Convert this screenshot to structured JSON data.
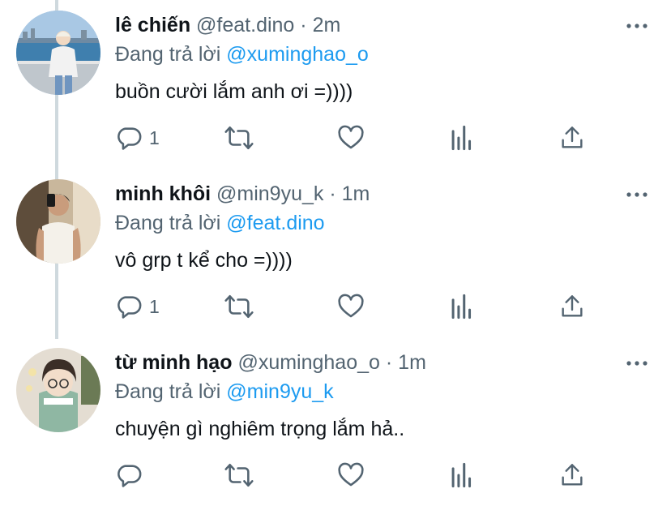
{
  "reply_prefix": "Đang trả lời",
  "tweets": [
    {
      "name": "lê chiến",
      "handle": "@feat.dino",
      "sep": "·",
      "time": "2m",
      "reply_to": "@xuminghao_o",
      "text": "buồn cười lắm anh ơi =))))",
      "reply_count": "1",
      "avatar": "avatar-photo-waterfront"
    },
    {
      "name": "minh khôi",
      "handle": "@min9yu_k",
      "sep": "·",
      "time": "1m",
      "reply_to": "@feat.dino",
      "text": "vô grp t kể cho =))))",
      "reply_count": "1",
      "avatar": "avatar-photo-mirror-selfie"
    },
    {
      "name": "từ minh hạo",
      "handle": "@xuminghao_o",
      "sep": "·",
      "time": "1m",
      "reply_to": "@min9yu_k",
      "text": "chuyện gì nghiêm trọng lắm hả..",
      "reply_count": "",
      "avatar": "avatar-photo-glasses"
    }
  ],
  "icons": [
    "reply-icon",
    "retweet-icon",
    "like-icon",
    "analytics-icon",
    "share-icon",
    "more-icon"
  ],
  "colors": {
    "text": "#0f1419",
    "secondary": "#536471",
    "mention": "#1d9bf0",
    "thread_line": "#cfd9de"
  }
}
